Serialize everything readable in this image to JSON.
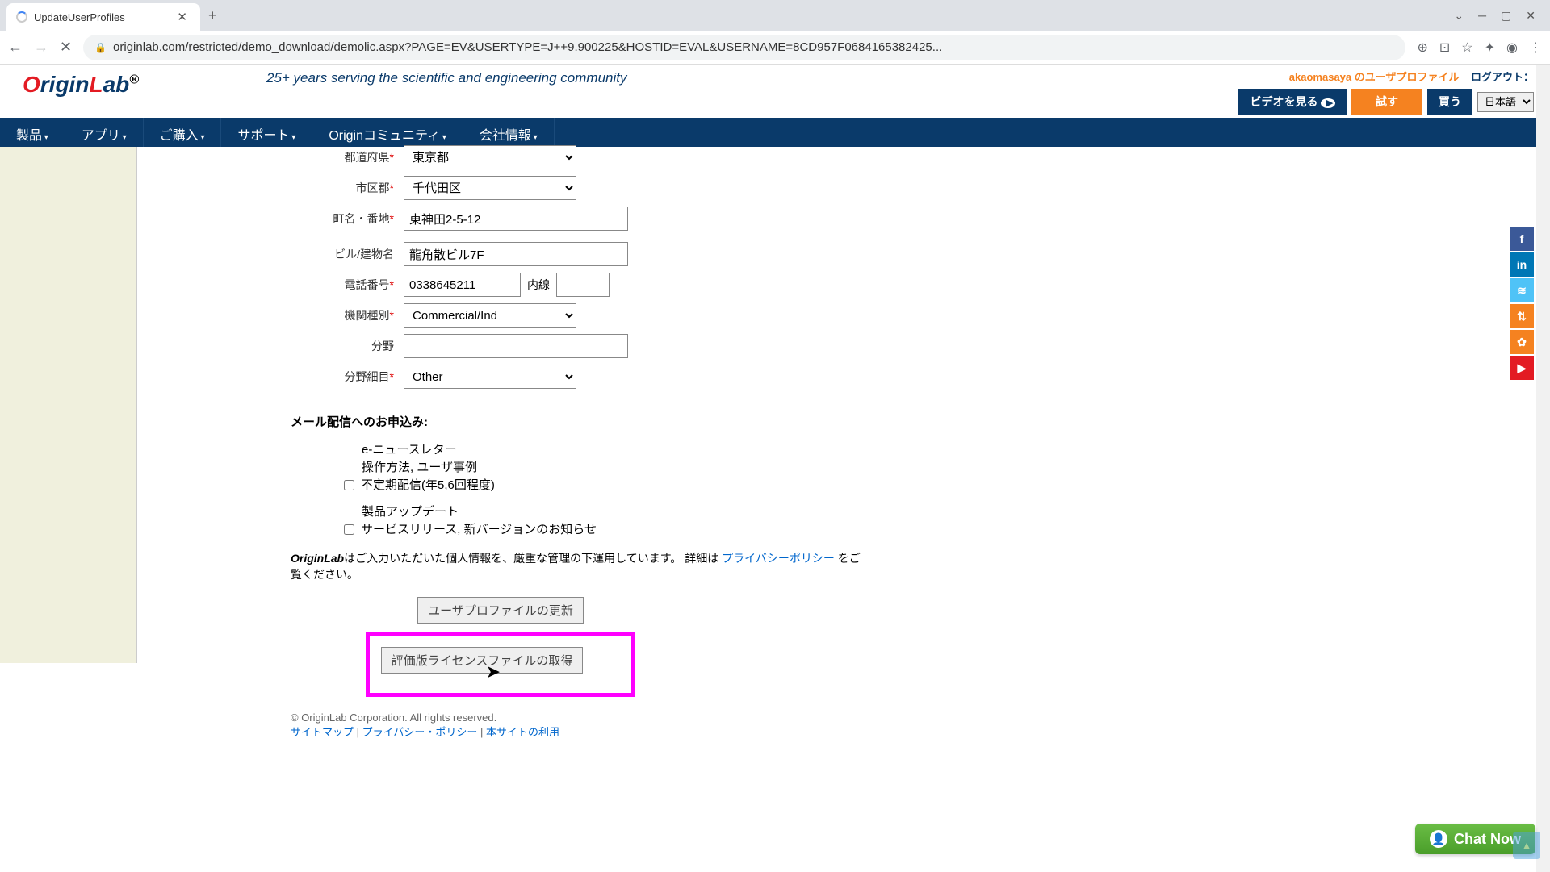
{
  "browser": {
    "tab_title": "UpdateUserProfiles",
    "url": "originlab.com/restricted/demo_download/demolic.aspx?PAGE=EV&USERTYPE=J++9.900225&HOSTID=EVAL&USERNAME=8CD957F0684165382425..."
  },
  "header": {
    "tagline": "25+ years serving the scientific and engineering community",
    "profile_link": "akaomasaya のユーザプロファイル",
    "logout_label": "ログアウト：",
    "btn_video": "ビデオを見る",
    "btn_try": "試す",
    "btn_buy": "買う",
    "lang": "日本語"
  },
  "nav": {
    "items": [
      "製品",
      "アプリ",
      "ご購入",
      "サポート",
      "Originコミュニティ",
      "会社情報"
    ]
  },
  "form": {
    "labels": {
      "prefecture": "都道府県",
      "city": "市区郡",
      "street": "町名・番地",
      "building": "ビル/建物名",
      "phone": "電話番号",
      "ext": "内線",
      "org_type": "機関種別",
      "dept": "分野",
      "dept_detail": "分野細目"
    },
    "values": {
      "prefecture": "東京都",
      "city": "千代田区",
      "street": "東神田2-5-12",
      "building": "龍角散ビル7F",
      "phone": "0338645211",
      "ext": "",
      "org_type": "Commercial/Ind",
      "dept": "",
      "dept_detail": "Other"
    }
  },
  "mail": {
    "heading": "メール配信へのお申込み:",
    "opt1_l1": "e-ニュースレター",
    "opt1_l2": "操作方法, ユーザ事例",
    "opt1_l3": "不定期配信(年5,6回程度)",
    "opt2_l1": "製品アップデート",
    "opt2_l2": "サービスリリース, 新バージョンのお知らせ"
  },
  "privacy": {
    "brand": "OriginLab",
    "text1": "はご入力いただいた個人情報を、厳重な管理の下運用しています。 詳細は ",
    "link": "プライバシーポリシー",
    "text2": " をご覧ください。"
  },
  "buttons": {
    "update": "ユーザプロファイルの更新",
    "eval": "評価版ライセンスファイルの取得"
  },
  "footer": {
    "copyright": "© OriginLab Corporation. All rights reserved.",
    "sitemap": "サイトマップ",
    "privacy": "プライバシー・ポリシー",
    "terms": "本サイトの利用"
  },
  "chat": "Chat Now"
}
